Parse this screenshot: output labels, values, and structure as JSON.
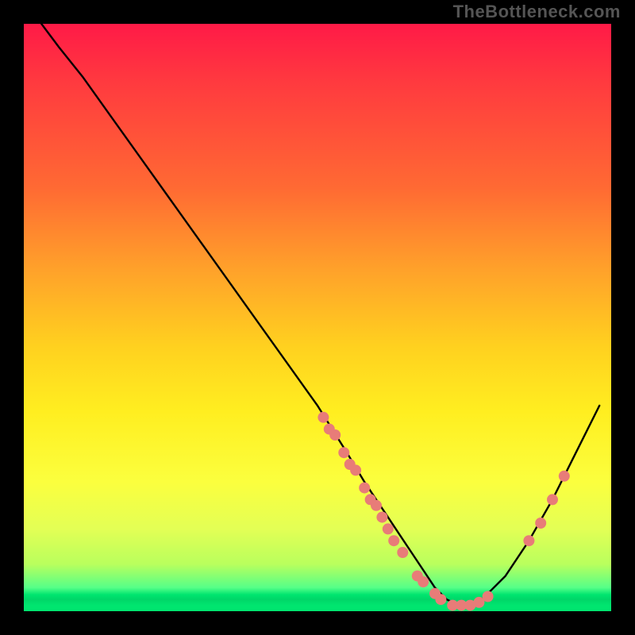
{
  "watermark": "TheBottleneck.com",
  "chart_data": {
    "type": "line",
    "title": "",
    "xlabel": "",
    "ylabel": "",
    "xlim": [
      0,
      100
    ],
    "ylim": [
      0,
      100
    ],
    "grid": false,
    "legend": false,
    "series": [
      {
        "name": "curve",
        "x": [
          3,
          6,
          10,
          15,
          20,
          25,
          30,
          35,
          40,
          45,
          50,
          55,
          58,
          60,
          62,
          64,
          66,
          68,
          70,
          72,
          74,
          76,
          78,
          82,
          86,
          90,
          94,
          98
        ],
        "y": [
          100,
          96,
          91,
          84,
          77,
          70,
          63,
          56,
          49,
          42,
          35,
          27,
          22,
          19,
          16,
          13,
          10,
          7,
          4,
          2,
          1,
          1,
          2,
          6,
          12,
          19,
          27,
          35
        ]
      }
    ],
    "points": [
      {
        "x": 51,
        "y": 33
      },
      {
        "x": 52,
        "y": 31
      },
      {
        "x": 53,
        "y": 30
      },
      {
        "x": 54.5,
        "y": 27
      },
      {
        "x": 55.5,
        "y": 25
      },
      {
        "x": 56.5,
        "y": 24
      },
      {
        "x": 58,
        "y": 21
      },
      {
        "x": 59,
        "y": 19
      },
      {
        "x": 60,
        "y": 18
      },
      {
        "x": 61,
        "y": 16
      },
      {
        "x": 62,
        "y": 14
      },
      {
        "x": 63,
        "y": 12
      },
      {
        "x": 64.5,
        "y": 10
      },
      {
        "x": 67,
        "y": 6
      },
      {
        "x": 68,
        "y": 5
      },
      {
        "x": 70,
        "y": 3
      },
      {
        "x": 71,
        "y": 2
      },
      {
        "x": 73,
        "y": 1
      },
      {
        "x": 74.5,
        "y": 1
      },
      {
        "x": 76,
        "y": 1
      },
      {
        "x": 77.5,
        "y": 1.5
      },
      {
        "x": 79,
        "y": 2.5
      },
      {
        "x": 86,
        "y": 12
      },
      {
        "x": 88,
        "y": 15
      },
      {
        "x": 90,
        "y": 19
      },
      {
        "x": 92,
        "y": 23
      }
    ],
    "background_gradient_stops": [
      {
        "pos": 0,
        "color": "#ff1a47"
      },
      {
        "pos": 28,
        "color": "#ff6a33"
      },
      {
        "pos": 55,
        "color": "#ffd11f"
      },
      {
        "pos": 78,
        "color": "#fbff3e"
      },
      {
        "pos": 96,
        "color": "#55ff88"
      },
      {
        "pos": 100,
        "color": "#00e56f"
      }
    ]
  }
}
